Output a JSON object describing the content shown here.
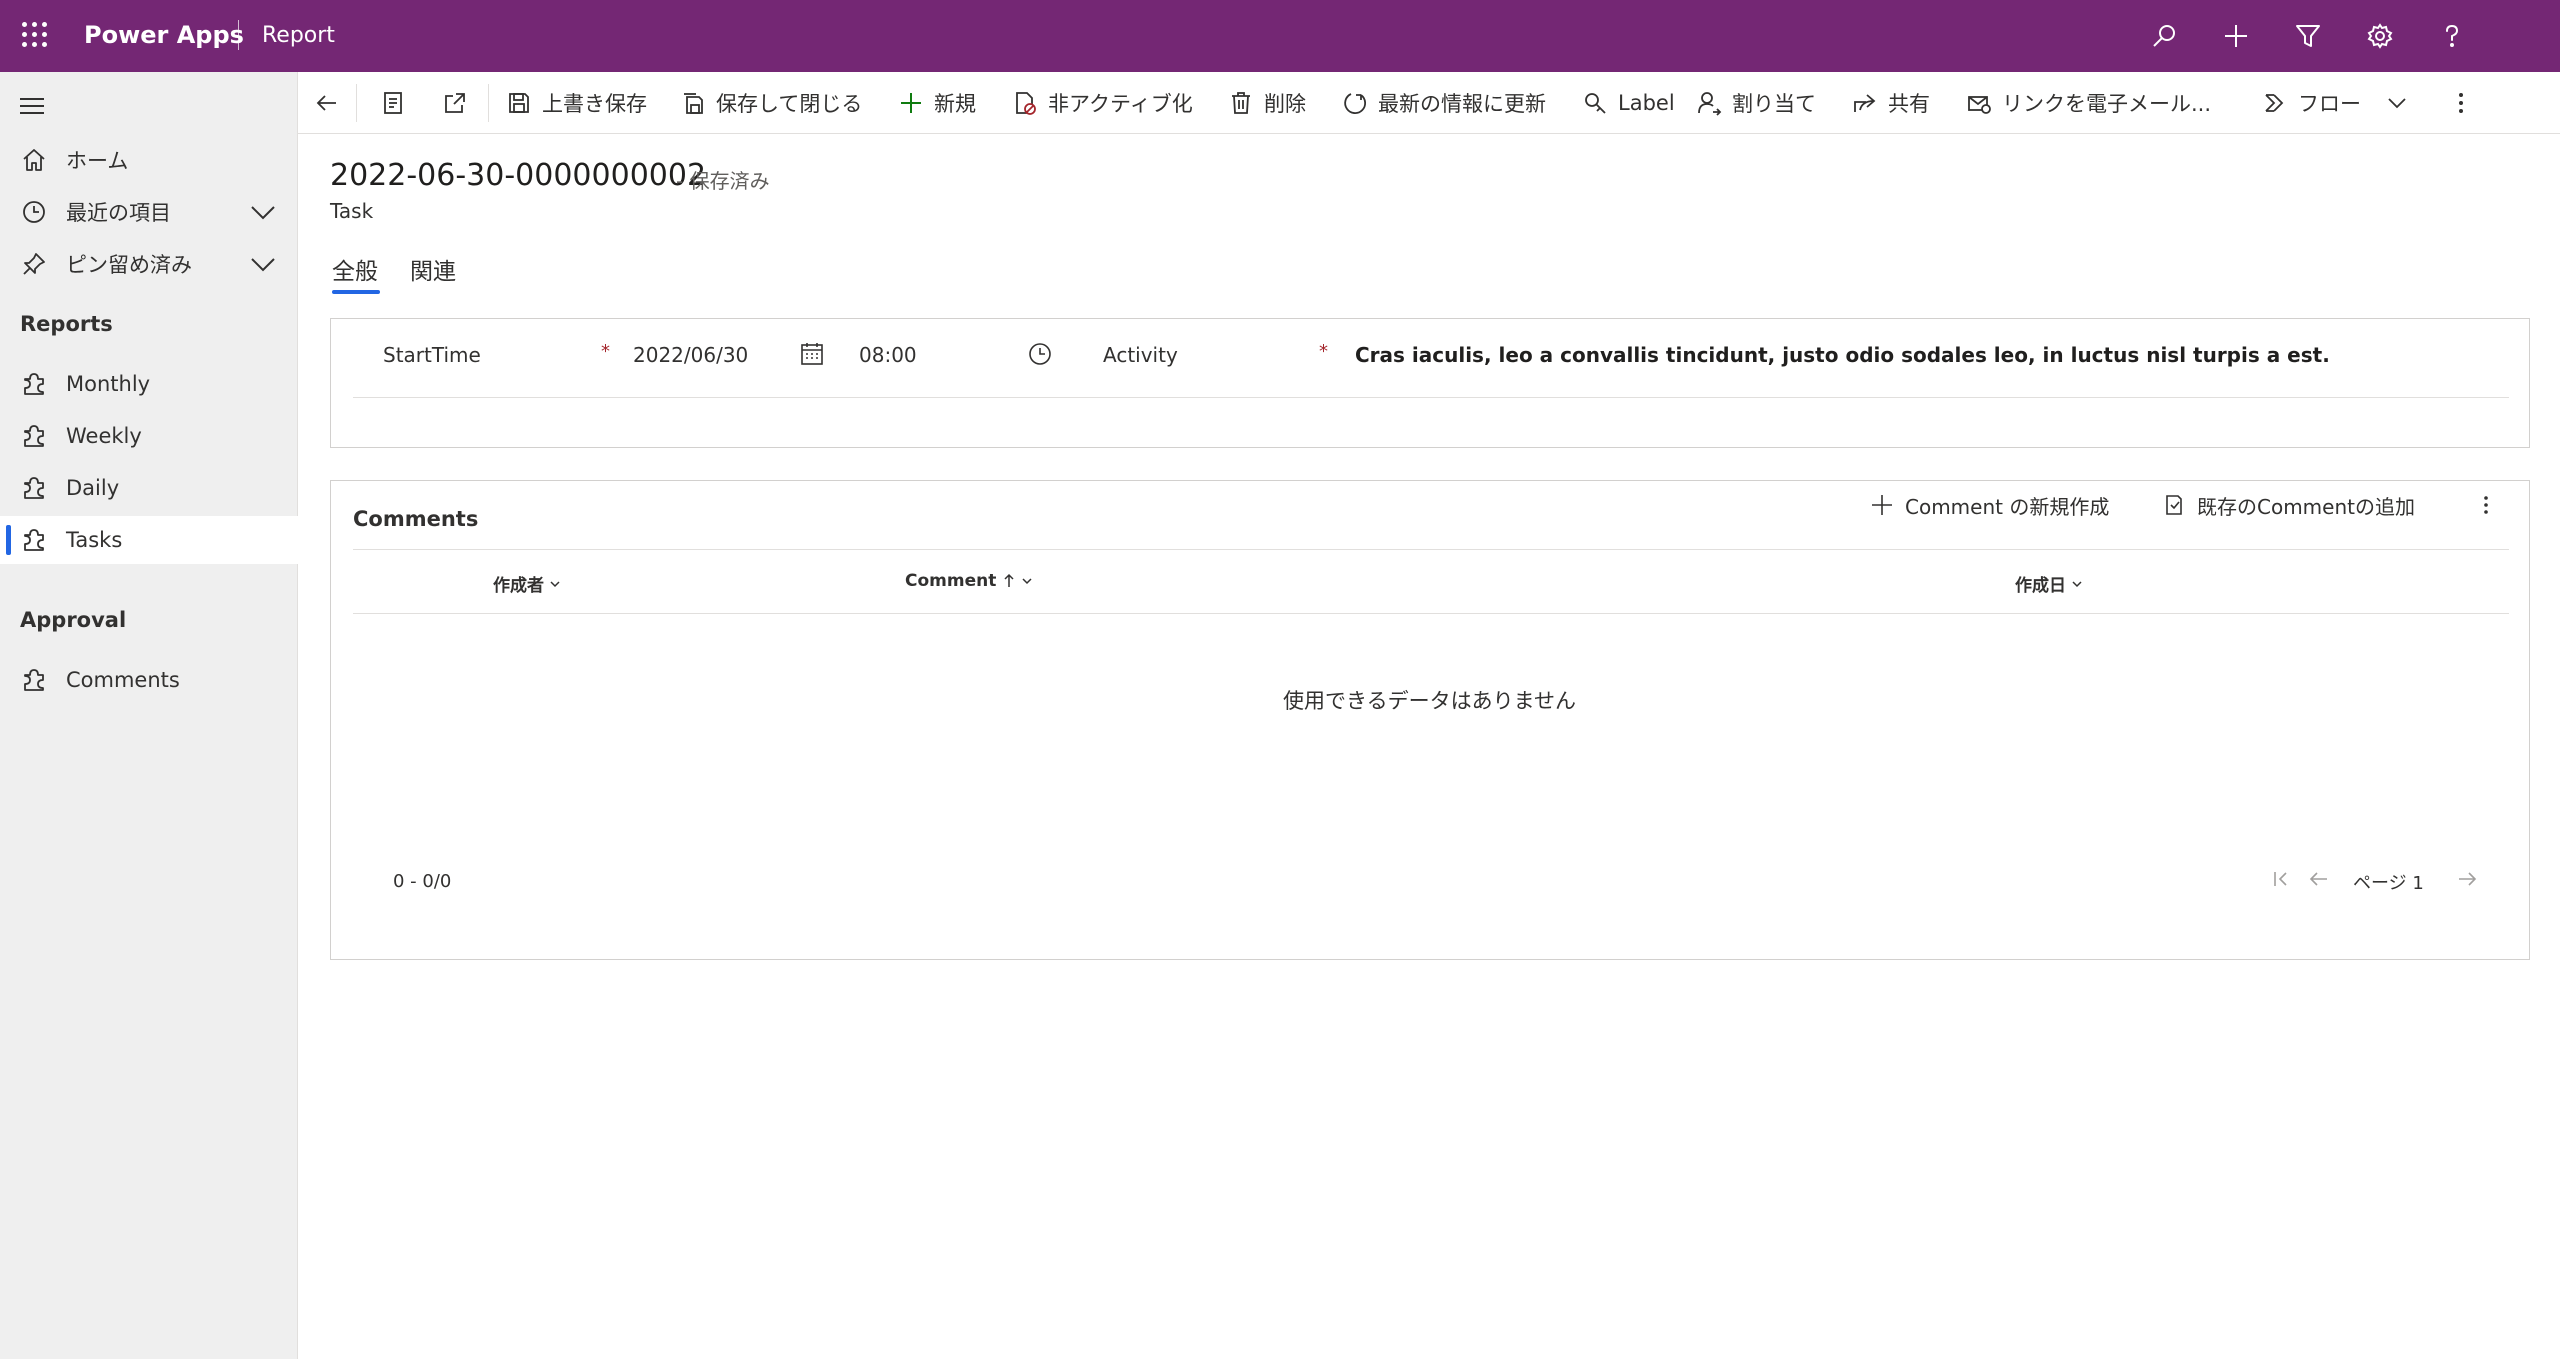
{
  "topbar": {
    "app_name": "Power Apps",
    "app_sub": "Report",
    "icons": [
      "search-icon",
      "plus-icon",
      "filter-icon",
      "gear-icon",
      "help-icon"
    ]
  },
  "sidebar": {
    "items": [
      {
        "label": "ホーム",
        "icon": "home-icon"
      },
      {
        "label": "最近の項目",
        "icon": "clock-icon"
      },
      {
        "label": "ピン留め済み",
        "icon": "pin-icon"
      }
    ],
    "groups": [
      {
        "title": "Reports",
        "items": [
          {
            "label": "Monthly",
            "icon": "puzzle-icon"
          },
          {
            "label": "Weekly",
            "icon": "puzzle-icon"
          },
          {
            "label": "Daily",
            "icon": "puzzle-icon"
          },
          {
            "label": "Tasks",
            "icon": "puzzle-icon",
            "active": true
          }
        ]
      },
      {
        "title": "Approval",
        "items": [
          {
            "label": "Comments",
            "icon": "puzzle-icon"
          }
        ]
      }
    ]
  },
  "commandbar": {
    "save": "上書き保存",
    "save_close": "保存して閉じる",
    "new": "新規",
    "deactivate": "非アクティブ化",
    "delete": "削除",
    "refresh": "最新の情報に更新",
    "label": "Label",
    "assign": "割り当て",
    "share": "共有",
    "email_link": "リンクを電子メール...",
    "flow": "フロー"
  },
  "record": {
    "title": "2022-06-30-0000000002",
    "status": "- 保存済み",
    "entity": "Task"
  },
  "tabs": [
    {
      "label": "全般",
      "selected": true
    },
    {
      "label": "関連",
      "selected": false
    }
  ],
  "form": {
    "start_time_label": "StartTime",
    "start_date": "2022/06/30",
    "start_time": "08:00",
    "activity_label": "Activity",
    "activity_value": "Cras iaculis, leo a convallis tincidunt, justo odio sodales leo, in luctus nisl turpis a est.",
    "required_mark": "*"
  },
  "comments": {
    "title": "Comments",
    "new_button": "Comment の新規作成",
    "add_existing_button": "既存のCommentの追加",
    "columns": [
      "作成者",
      "Comment",
      "作成日"
    ],
    "empty_message": "使用できるデータはありません",
    "count": "0 - 0/0",
    "page_label": "ページ 1"
  },
  "colors": {
    "topbar": "#742774",
    "accent": "#2266e3",
    "required": "#a4262c"
  }
}
